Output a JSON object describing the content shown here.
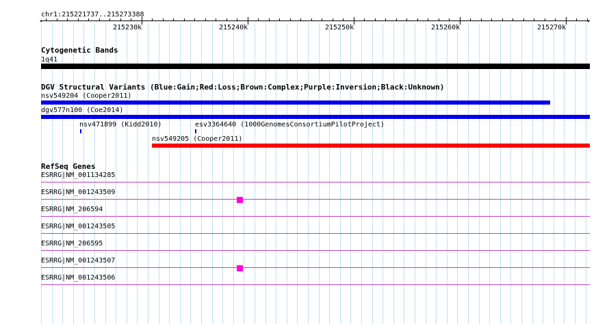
{
  "location": "chr1:215221737..215273388",
  "ruler": {
    "ticks": [
      "215230k",
      "215240k",
      "215250k",
      "215260k",
      "215270k"
    ]
  },
  "colors": {
    "black": "#000000",
    "gain": "#0000ee",
    "loss": "#ff0000",
    "gene": "#c040c0",
    "exon": "#ff00dd",
    "grid": "#c4e0ee"
  },
  "cytoband": {
    "title": "Cytogenetic Bands",
    "band_label": "1q41"
  },
  "dgv": {
    "title": "DGV Structural Variants (Blue:Gain;Red:Loss;Brown:Complex;Purple:Inversion;Black:Unknown)",
    "features": [
      {
        "label": "nsv549204 (Cooper2011)"
      },
      {
        "label": "dgv577n100 (Coe2014)"
      },
      {
        "label": "nsv471899 (Kidd2010)"
      },
      {
        "label": "esv3364640 (1000GenomesConsortiumPilotProject)"
      },
      {
        "label": "nsv549205 (Cooper2011)"
      }
    ]
  },
  "refseq": {
    "title": "RefSeq Genes",
    "genes": [
      {
        "label": "ESRRG|NM_001134285"
      },
      {
        "label": "ESRRG|NM_001243509"
      },
      {
        "label": "ESRRG|NM_206594"
      },
      {
        "label": "ESRRG|NM_001243505"
      },
      {
        "label": "ESRRG|NM_206595"
      },
      {
        "label": "ESRRG|NM_001243507"
      },
      {
        "label": "ESRRG|NM_001243506"
      }
    ]
  }
}
